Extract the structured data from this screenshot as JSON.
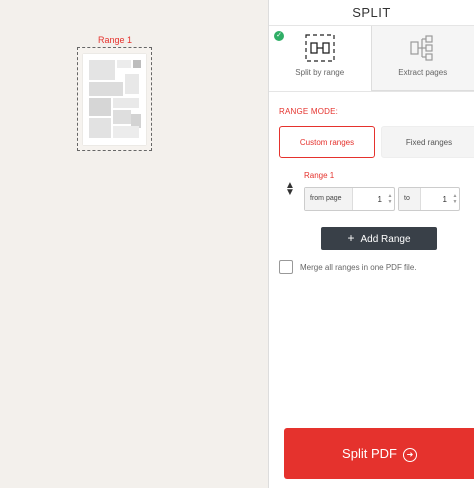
{
  "preview": {
    "range_caption": "Range 1"
  },
  "panel": {
    "title": "SPLIT",
    "tabs": [
      {
        "label": "Split by range",
        "icon": "split-range-icon",
        "active": true
      },
      {
        "label": "Extract pages",
        "icon": "extract-pages-icon",
        "active": false
      }
    ],
    "range_mode_label": "RANGE MODE:",
    "custom_ranges_label": "Custom ranges",
    "fixed_ranges_label": "Fixed ranges",
    "range": {
      "name": "Range 1",
      "from_label": "from page",
      "from_value": "1",
      "to_label": "to",
      "to_value": "1"
    },
    "add_range_label": "Add Range",
    "merge_label": "Merge all ranges in one PDF file.",
    "split_button_label": "Split PDF"
  },
  "colors": {
    "accent": "#e5322d",
    "dark_button": "#394048",
    "check": "#2fae66"
  }
}
